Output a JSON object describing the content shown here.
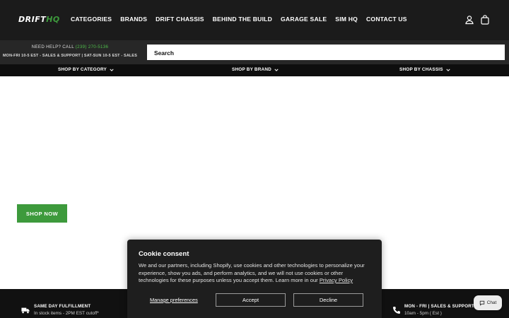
{
  "header": {
    "logo_main": "DRIFT",
    "logo_accent": "HQ",
    "nav": [
      "CATEGORIES",
      "BRANDS",
      "DRIFT CHASSIS",
      "BEHIND THE BUILD",
      "GARAGE SALE",
      "SIM HQ",
      "CONTACT US"
    ],
    "account_icon": "user-icon",
    "cart_icon": "bag-icon"
  },
  "utility": {
    "help_prefix": "NEED HELP? CALL",
    "help_phone": "(239) 270-5136",
    "hours": "MON-FRI 10-5 EST - SALES & SUPPORT | SAT-SUN 10-5 EST - SALES"
  },
  "search": {
    "placeholder": "Search"
  },
  "shopbar": {
    "category": "SHOP BY CATEGORY",
    "brand": "SHOP BY BRAND",
    "chassis": "SHOP BY CHASSIS"
  },
  "hero": {
    "cta": "SHOP NOW"
  },
  "features": {
    "left_title": "SAME DAY FULFILLMENT",
    "left_sub": "In stock items - 2PM EST cutoff*",
    "right_title": "MON - FRI  |  SALES & SUPPORT SAT -",
    "right_sub": "10am - 5pm ( Est )"
  },
  "cookie": {
    "title": "Cookie consent",
    "body": "We and our partners, including Shopify, use cookies and other technologies to personalize your experience, show you ads, and perform analytics, and we will not use cookies or other technologies for these purposes unless you accept them. Learn more in our",
    "policy_link": "Privacy Policy",
    "manage": "Manage preferences",
    "accept": "Accept",
    "decline": "Decline"
  },
  "chat": {
    "label": "Chat"
  },
  "colors": {
    "brand_green": "#3d9a3c",
    "header_bg": "#1b1b1b",
    "modal_bg": "#1e1e1e"
  }
}
